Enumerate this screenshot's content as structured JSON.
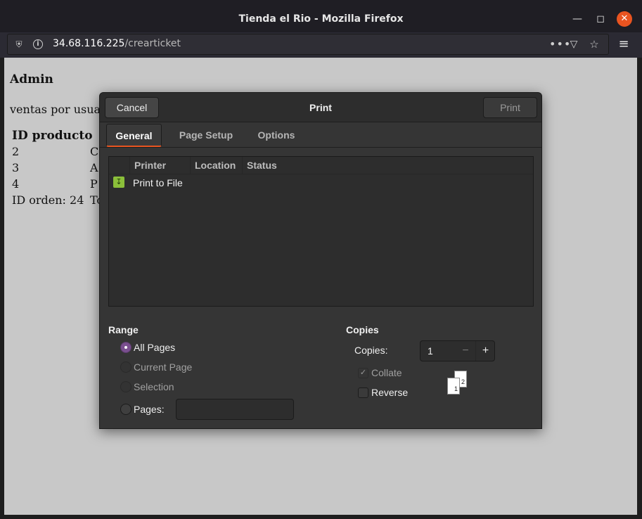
{
  "window": {
    "title": "Tienda el Rio - Mozilla Firefox",
    "min_icon": "minimize-icon",
    "max_icon": "maximize-icon",
    "close_icon": "close-icon"
  },
  "urlbar": {
    "host": "34.68.116.225",
    "path": "/crearticket"
  },
  "page": {
    "heading": "Admin",
    "subtitle": "ventas por usua",
    "table_header": "ID producto",
    "rows": [
      {
        "id": "2",
        "col2": "C"
      },
      {
        "id": "3",
        "col2": "A"
      },
      {
        "id": "4",
        "col2": "P"
      }
    ],
    "order_line": "ID orden: 24",
    "order_col2": "To"
  },
  "dialog": {
    "title": "Print",
    "cancel_label": "Cancel",
    "print_label": "Print",
    "tabs": [
      {
        "label": "General"
      },
      {
        "label": "Page Setup"
      },
      {
        "label": "Options"
      }
    ],
    "printer_columns": {
      "printer": "Printer",
      "location": "Location",
      "status": "Status"
    },
    "printers": [
      {
        "name": "Print to File",
        "icon": "print-to-file-icon"
      }
    ],
    "range": {
      "title": "Range",
      "options": [
        {
          "label": "All Pages",
          "selected": true,
          "enabled": true
        },
        {
          "label": "Current Page",
          "selected": false,
          "enabled": false
        },
        {
          "label": "Selection",
          "selected": false,
          "enabled": false
        },
        {
          "label": "Pages:",
          "selected": false,
          "enabled": true
        }
      ],
      "pages_value": ""
    },
    "copies": {
      "title": "Copies",
      "label": "Copies:",
      "value": "1",
      "collate_label": "Collate",
      "collate_checked": true,
      "reverse_label": "Reverse",
      "reverse_checked": false,
      "sheet_back": "2",
      "sheet_front": "1"
    }
  },
  "colors": {
    "accent": "#e95420",
    "radio_selected": "#7a4f8f"
  }
}
